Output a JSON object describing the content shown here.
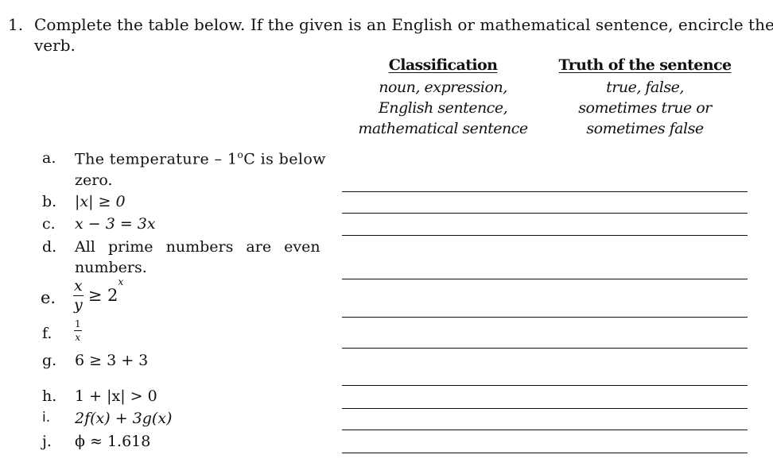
{
  "question": {
    "number": "1.",
    "text_line1": "Complete the table below. If the given is an English or mathematical sentence, encircle the",
    "text_line2": "verb."
  },
  "columns": [
    {
      "heading": "Classification",
      "options": [
        "noun, expression,",
        "English sentence,",
        "mathematical sentence"
      ]
    },
    {
      "heading": "Truth of the sentence",
      "options": [
        "true, false,",
        "sometimes true or",
        "sometimes false"
      ]
    }
  ],
  "items": [
    {
      "label": "a.",
      "line1": "The temperature – 1",
      "sup": "o",
      "line1_end": "C is below",
      "line2": "zero."
    },
    {
      "label": "b.",
      "expr": "|x| ≥ 0"
    },
    {
      "label": "c.",
      "expr": "x − 3 = 3x"
    },
    {
      "label": "d.",
      "line1": "All  prime  numbers  are  even",
      "line2": "numbers."
    },
    {
      "label": "e.",
      "num": "x",
      "den": "y",
      "rel": "≥ 2",
      "exp": "x"
    },
    {
      "label": "f.",
      "num": "1",
      "den": "x"
    },
    {
      "label": "g.",
      "expr": "6 ≥ 3 + 3"
    },
    {
      "label": "h.",
      "expr": "1 + |x| > 0"
    },
    {
      "label": "i.",
      "expr": "2f(x) + 3g(x)"
    },
    {
      "label": "j.",
      "expr": "ϕ ≈ 1.618"
    }
  ]
}
